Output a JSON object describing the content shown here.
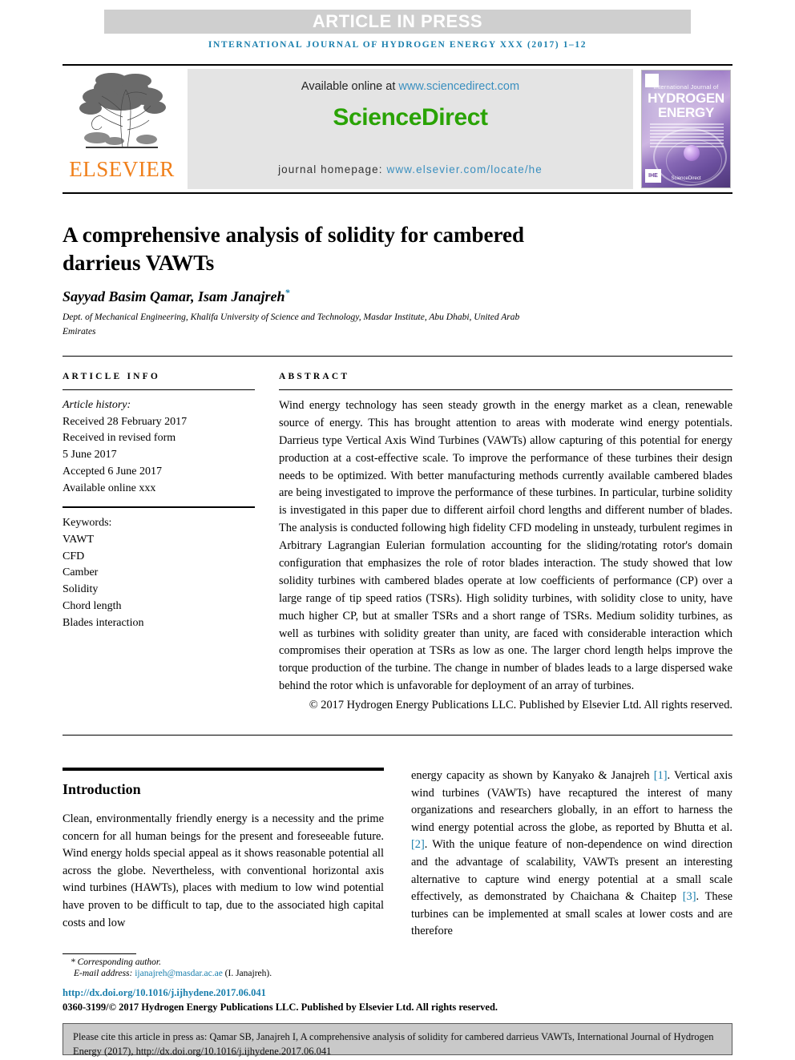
{
  "banner": {
    "text": "ARTICLE IN PRESS",
    "bg_color": "#cfcfcf"
  },
  "running_head": {
    "text": "INTERNATIONAL JOURNAL OF HYDROGEN ENERGY XXX (2017) 1–12",
    "color": "#1a7fad"
  },
  "masthead": {
    "publisher_name": "ELSEVIER",
    "publisher_color": "#f07f1a",
    "available_prefix": "Available online at ",
    "available_url": "www.sciencedirect.com",
    "sciencedirect_logo": "ScienceDirect",
    "sciencedirect_color": "#2aa305",
    "homepage_prefix": "journal homepage: ",
    "homepage_url": "www.elsevier.com/locate/he",
    "link_color": "#3a8fbf",
    "cover": {
      "top_label": "International Journal of",
      "title_line1": "HYDROGEN",
      "title_line2": "ENERGY",
      "footer_label": "ScienceDirect"
    }
  },
  "article": {
    "title": "A comprehensive analysis of solidity for cambered darrieus VAWTs",
    "authors": "Sayyad Basim Qamar, Isam Janajreh",
    "corresponding_marker": "*",
    "affiliation": "Dept. of Mechanical Engineering, Khalifa University of Science and Technology, Masdar Institute, Abu Dhabi, United Arab Emirates"
  },
  "article_info": {
    "heading": "ARTICLE INFO",
    "history_label": "Article history:",
    "history": [
      "Received 28 February 2017",
      "Received in revised form",
      "5 June 2017",
      "Accepted 6 June 2017",
      "Available online xxx"
    ],
    "keywords_label": "Keywords:",
    "keywords": [
      "VAWT",
      "CFD",
      "Camber",
      "Solidity",
      "Chord length",
      "Blades interaction"
    ]
  },
  "abstract": {
    "heading": "ABSTRACT",
    "text": "Wind energy technology has seen steady growth in the energy market as a clean, renewable source of energy. This has brought attention to areas with moderate wind energy potentials. Darrieus type Vertical Axis Wind Turbines (VAWTs) allow capturing of this potential for energy production at a cost-effective scale. To improve the performance of these turbines their design needs to be optimized. With better manufacturing methods currently available cambered blades are being investigated to improve the performance of these turbines. In particular, turbine solidity is investigated in this paper due to different airfoil chord lengths and different number of blades. The analysis is conducted following high fidelity CFD modeling in unsteady, turbulent regimes in Arbitrary Lagrangian Eulerian formulation accounting for the sliding/rotating rotor's domain configuration that emphasizes the role of rotor blades interaction. The study showed that low solidity turbines with cambered blades operate at low coefficients of performance (CP) over a large range of tip speed ratios (TSRs). High solidity turbines, with solidity close to unity, have much higher CP, but at smaller TSRs and a short range of TSRs. Medium solidity turbines, as well as turbines with solidity greater than unity, are faced with considerable interaction which compromises their operation at TSRs as low as one. The larger chord length helps improve the torque production of the turbine. The change in number of blades leads to a large dispersed wake behind the rotor which is unfavorable for deployment of an array of turbines.",
    "copyright": "© 2017 Hydrogen Energy Publications LLC. Published by Elsevier Ltd. All rights reserved."
  },
  "introduction": {
    "heading": "Introduction",
    "left_text": "Clean, environmentally friendly energy is a necessity and the prime concern for all human beings for the present and foreseeable future. Wind energy holds special appeal as it shows reasonable potential all across the globe. Nevertheless, with conventional horizontal axis wind turbines (HAWTs), places with medium to low wind potential have proven to be difficult to tap, due to the associated high capital costs and low",
    "right_part1": "energy capacity as shown by Kanyako & Janajreh ",
    "right_ref1": "[1]",
    "right_part2": ". Vertical axis wind turbines (VAWTs) have recaptured the interest of many organizations and researchers globally, in an effort to harness the wind energy potential across the globe, as reported by Bhutta et al. ",
    "right_ref2": "[2]",
    "right_part3": ". With the unique feature of non-dependence on wind direction and the advantage of scalability, VAWTs present an interesting alternative to capture wind energy potential at a small scale effectively, as demonstrated by Chaichana & Chaitep ",
    "right_ref3": "[3]",
    "right_part4": ". These turbines can be implemented at small scales at lower costs and are therefore",
    "ref_color": "#1a7fad"
  },
  "footer": {
    "corresponding_marker": "*",
    "corresponding_label": "Corresponding author.",
    "email_label": "E-mail address: ",
    "email": "ijanajreh@masdar.ac.ae",
    "email_owner": "(I. Janajreh).",
    "doi_url": "http://dx.doi.org/10.1016/j.ijhydene.2017.06.041",
    "issn_line": "0360-3199/© 2017 Hydrogen Energy Publications LLC. Published by Elsevier Ltd. All rights reserved.",
    "cite_box": "Please cite this article in press as: Qamar SB, Janajreh I, A comprehensive analysis of solidity for cambered darrieus VAWTs, International Journal of Hydrogen Energy (2017), http://dx.doi.org/10.1016/j.ijhydene.2017.06.041"
  }
}
